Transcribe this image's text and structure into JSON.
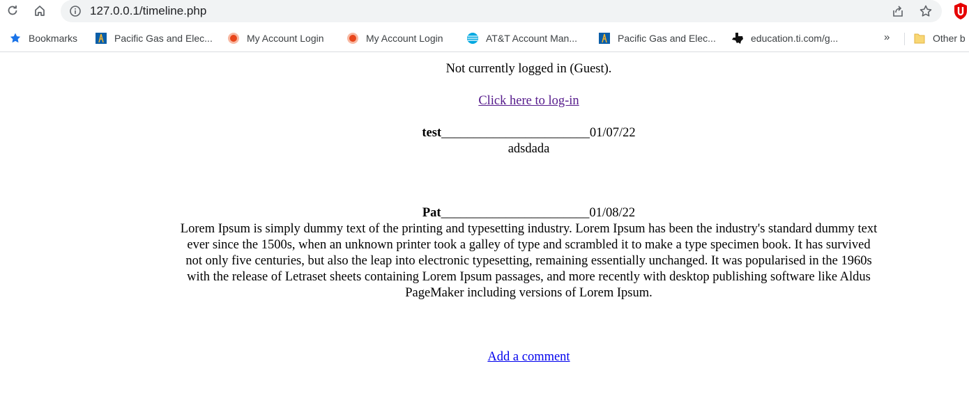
{
  "browser": {
    "url": "127.0.0.1/timeline.php",
    "bookmarks": [
      {
        "label": "Bookmarks",
        "icon": "star-icon"
      },
      {
        "label": "Pacific Gas and Elec...",
        "icon": "pge-icon"
      },
      {
        "label": "My Account Login",
        "icon": "orange-circle-icon"
      },
      {
        "label": "My Account Login",
        "icon": "orange-circle-icon"
      },
      {
        "label": "AT&T Account Man...",
        "icon": "att-globe-icon"
      },
      {
        "label": "Pacific Gas and Elec...",
        "icon": "pge-icon"
      },
      {
        "label": "education.ti.com/g...",
        "icon": "ti-texas-icon"
      }
    ],
    "more_label": "»",
    "other_bookmarks": "Other b"
  },
  "page": {
    "status": "Not currently logged in (Guest).",
    "login_link": "Click here to log-in",
    "posts": [
      {
        "author": "test",
        "separator": "_______________________",
        "date": "01/07/22",
        "body": "adsdada"
      },
      {
        "author": "Pat",
        "separator": "_______________________",
        "date": "01/08/22",
        "body": "Lorem Ipsum is simply dummy text of the printing and typesetting industry. Lorem Ipsum has been the industry's standard dummy text ever since the 1500s, when an unknown printer took a galley of type and scrambled it to make a type specimen book. It has survived not only five centuries, but also the leap into electronic typesetting, remaining essentially unchanged. It was popularised in the 1960s with the release of Letraset sheets containing Lorem Ipsum passages, and more recently with desktop publishing software like Aldus PageMaker including versions of Lorem Ipsum."
      }
    ],
    "add_comment": "Add a comment"
  },
  "colors": {
    "visited_link": "#551a8b",
    "link": "#0000ee",
    "omnibox_bg": "#f1f3f4",
    "bookmark_star": "#1a73e8"
  }
}
